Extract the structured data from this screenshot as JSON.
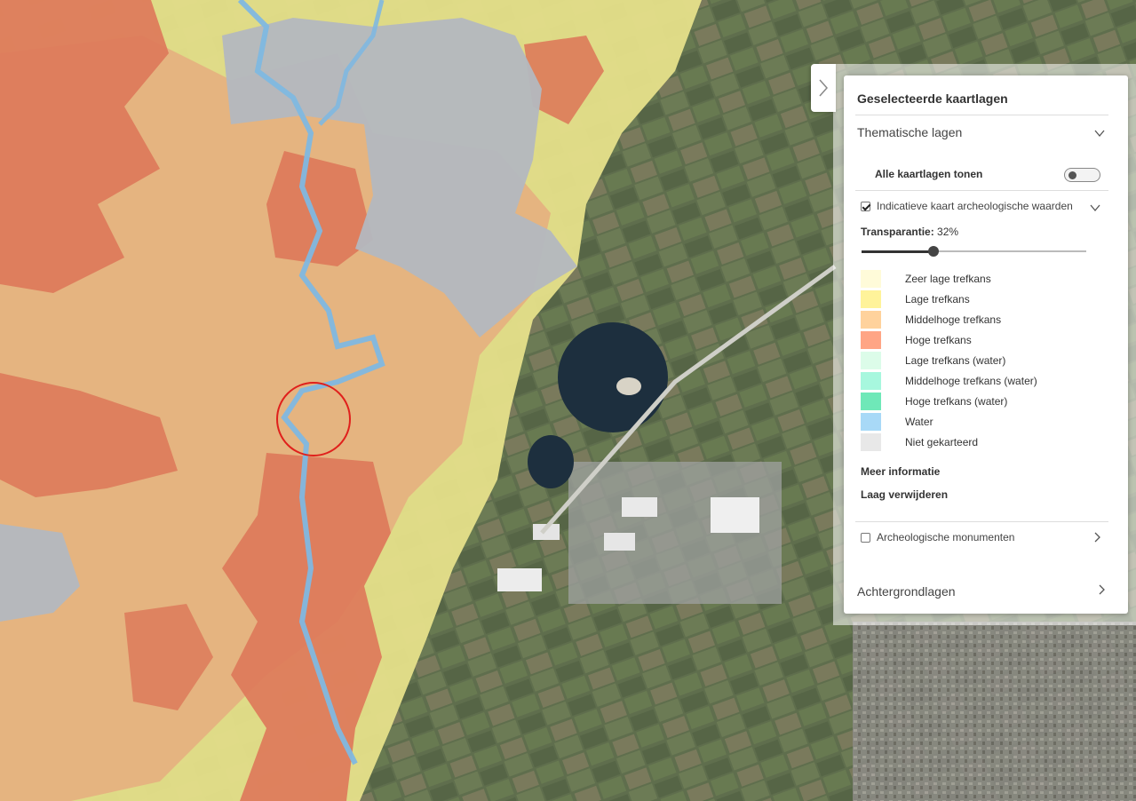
{
  "panel": {
    "title": "Geselecteerde kaartlagen",
    "thematic_section": "Thematische lagen",
    "show_all_label": "Alle kaartlagen tonen",
    "show_all_enabled": false,
    "layers": [
      {
        "label": "Indicatieve kaart archeologische waarden",
        "checked": true,
        "expanded": true,
        "transparency_label": "Transparantie:",
        "transparency_value": "32%",
        "transparency_fraction": 0.32,
        "legend": [
          {
            "label": "Zeer lage trefkans",
            "color": "#fffbd9"
          },
          {
            "label": "Lage trefkans",
            "color": "#fff39a"
          },
          {
            "label": "Middelhoge trefkans",
            "color": "#ffd29c"
          },
          {
            "label": "Hoge trefkans",
            "color": "#ffa585"
          },
          {
            "label": "Lage trefkans (water)",
            "color": "#dcfce9"
          },
          {
            "label": "Middelhoge trefkans (water)",
            "color": "#a7f7de"
          },
          {
            "label": "Hoge trefkans (water)",
            "color": "#6fe8b8"
          },
          {
            "label": "Water",
            "color": "#a8d9f7"
          },
          {
            "label": "Niet gekarteerd",
            "color": "#e8e8e8"
          }
        ],
        "more_info": "Meer informatie",
        "remove": "Laag verwijderen"
      },
      {
        "label": "Archeologische monumenten",
        "checked": false,
        "expanded": false
      }
    ],
    "background_section": "Achtergrondlagen"
  },
  "map": {
    "marker_color": "#e0201c",
    "colors": {
      "yellow": "#e6e08a",
      "orange": "#e5b27f",
      "red": "#dd7a5a",
      "water": "#7fb8e0",
      "grey": "#b3b8bf",
      "aerial": "#5c6b4c",
      "lake": "#1d2f3e"
    }
  }
}
